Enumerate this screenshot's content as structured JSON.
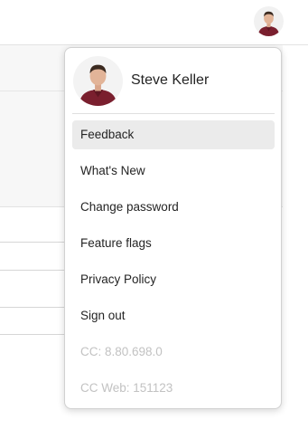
{
  "topbar": {
    "avatar_icon": "user-avatar-icon"
  },
  "menu": {
    "user_name": "Steve Keller",
    "items": [
      {
        "label": "Feedback"
      },
      {
        "label": "What's New"
      },
      {
        "label": "Change password"
      },
      {
        "label": "Feature flags"
      },
      {
        "label": "Privacy Policy"
      },
      {
        "label": "Sign out"
      }
    ],
    "versions": [
      {
        "label": "CC: 8.80.698.0"
      },
      {
        "label": "CC Web: 151123"
      }
    ],
    "highlight_color": "#ebebeb",
    "muted_text_color": "#c2c2c2"
  }
}
